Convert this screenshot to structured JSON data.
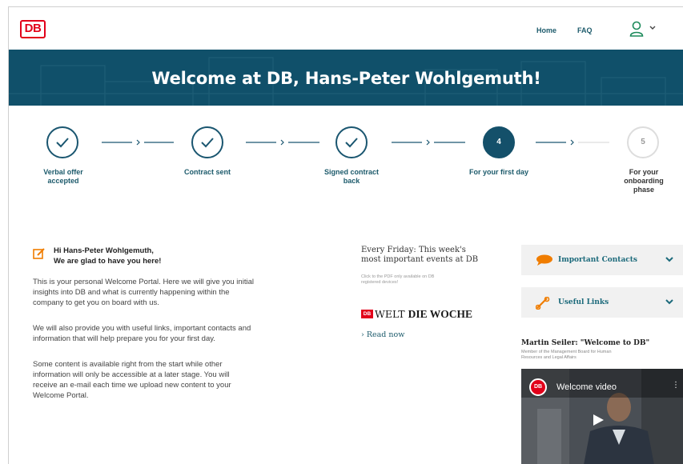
{
  "header": {
    "logo_text": "DB",
    "nav": [
      {
        "label": "Home"
      },
      {
        "label": "FAQ"
      }
    ],
    "user_icon": "user-icon",
    "caret_icon": "chevron-down-icon"
  },
  "banner": {
    "title": "Welcome at DB, Hans-Peter Wohlgemuth!"
  },
  "steps": [
    {
      "status": "done",
      "symbol": "",
      "label_line1": "Verbal offer",
      "label_line2": "accepted",
      "label_line3": ""
    },
    {
      "status": "done",
      "symbol": "",
      "label_line1": "Contract sent",
      "label_line2": "",
      "label_line3": ""
    },
    {
      "status": "done",
      "symbol": "",
      "label_line1": "Signed contract",
      "label_line2": "back",
      "label_line3": ""
    },
    {
      "status": "active",
      "symbol": "4",
      "label_line1": "For your first day",
      "label_line2": "",
      "label_line3": ""
    },
    {
      "status": "future",
      "symbol": "5",
      "label_line1": "For your",
      "label_line2": "onboarding",
      "label_line3": "phase"
    }
  ],
  "greeting": {
    "line1": "Hi Hans-Peter Wohlgemuth,",
    "line2": "We are glad to have you here!",
    "icon": "edit-icon"
  },
  "paragraphs": [
    {
      "lines": [
        "This is your personal Welcome Portal. Here we will give you initial",
        "insights into DB and what is currently happening within the",
        "company to get you on board with us."
      ]
    },
    {
      "lines": [
        "We will also provide you with useful links, important contacts and",
        "information that will help prepare you for your first day."
      ]
    },
    {
      "lines": [
        "Some content is available right from the start while other",
        "information will only be accessible at a later stage. You will",
        "receive an e-mail each time we upload new content to your",
        "Welcome Portal."
      ]
    }
  ],
  "weekly": {
    "line1": "Every Friday: This week's",
    "line2": "most important events at DB",
    "note_line1": "Click to the PDF only available on DB",
    "note_line2": "registered devices!",
    "badge": "DB",
    "brand_a": "WELT",
    "brand_b": "DIE WOCHE",
    "read_more": "› Read now"
  },
  "accordions": [
    {
      "label": "Important Contacts",
      "icon": "chat-bubble-icon",
      "caret": "chevron-down-icon"
    },
    {
      "label": "Useful Links",
      "icon": "link-icon",
      "caret": "chevron-down-icon"
    }
  ],
  "video": {
    "heading": "Martin Seiler: \"Welcome to DB\"",
    "sub_line1": "Member of the Management Board for Human",
    "sub_line2": "Resources and Legal Affairs",
    "logo": "DB",
    "player_title": "Welcome video",
    "menu_icon": "more-vertical-icon",
    "play_icon": "play-icon"
  },
  "colors": {
    "brand_red": "#e2001a",
    "banner_blue": "#10506a",
    "accent_orange": "#f07d00",
    "link_teal": "#1c6a7b"
  }
}
